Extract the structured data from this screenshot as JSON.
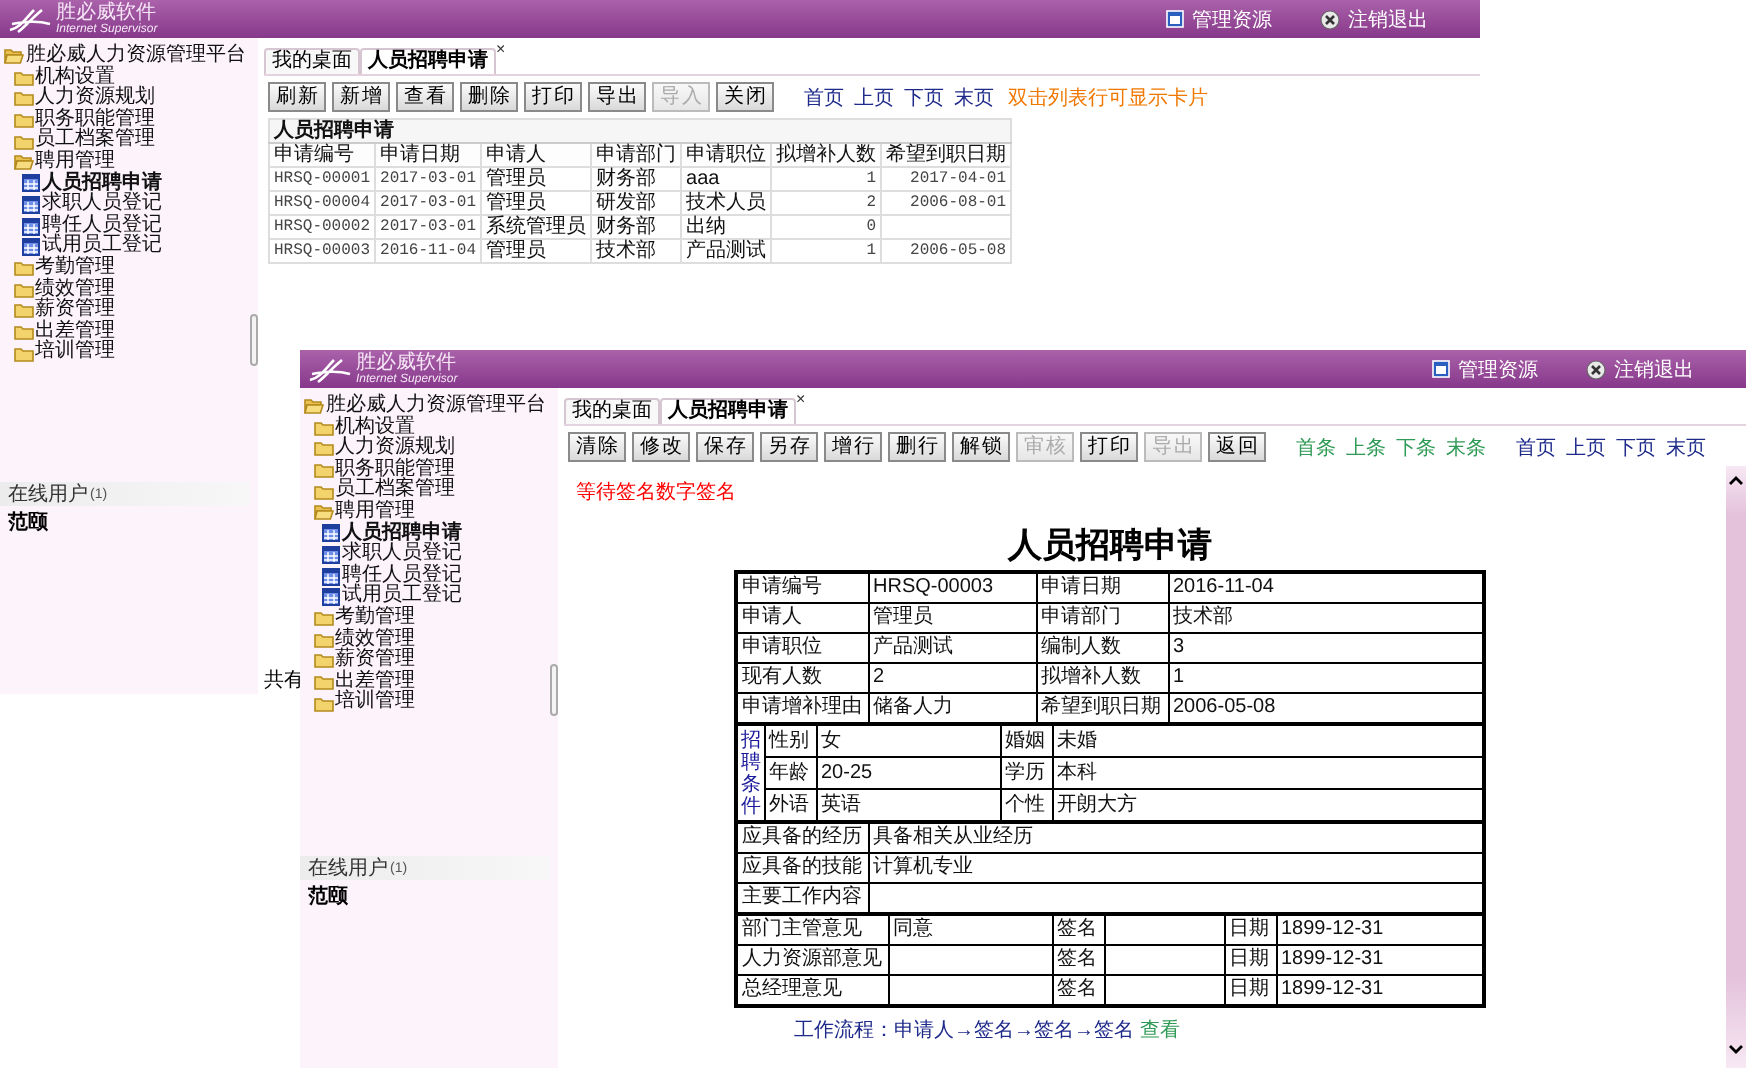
{
  "windows": [
    {
      "kind": "list",
      "header": {
        "logo_title": "胜必威软件",
        "logo_subtitle": "Internet Supervisor",
        "links": [
          {
            "label": "管理资源",
            "kind": "resources"
          },
          {
            "label": "注销退出",
            "kind": "logout"
          }
        ]
      },
      "sidebar": {
        "tree": [
          {
            "label": "胜必威人力资源管理平台",
            "kind": "folder",
            "expanded": true,
            "selected": false,
            "children": [
              {
                "label": "机构设置",
                "kind": "folder",
                "expanded": false,
                "selected": false
              },
              {
                "label": "人力资源规划",
                "kind": "folder",
                "expanded": false,
                "selected": false
              },
              {
                "label": "职务职能管理",
                "kind": "folder",
                "expanded": false,
                "selected": false
              },
              {
                "label": "员工档案管理",
                "kind": "folder",
                "expanded": false,
                "selected": false
              },
              {
                "label": "聘用管理",
                "kind": "folder",
                "expanded": true,
                "selected": false,
                "children": [
                  {
                    "label": "人员招聘申请",
                    "kind": "page",
                    "selected": true
                  },
                  {
                    "label": "求职人员登记",
                    "kind": "page",
                    "selected": false
                  },
                  {
                    "label": "聘任人员登记",
                    "kind": "page",
                    "selected": false
                  },
                  {
                    "label": "试用员工登记",
                    "kind": "page",
                    "selected": false
                  }
                ]
              },
              {
                "label": "考勤管理",
                "kind": "folder",
                "expanded": false,
                "selected": false
              },
              {
                "label": "绩效管理",
                "kind": "folder",
                "expanded": false,
                "selected": false
              },
              {
                "label": "薪资管理",
                "kind": "folder",
                "expanded": false,
                "selected": false
              },
              {
                "label": "出差管理",
                "kind": "folder",
                "expanded": false,
                "selected": false
              },
              {
                "label": "培训管理",
                "kind": "folder",
                "expanded": false,
                "selected": false
              }
            ]
          }
        ],
        "online_users": {
          "label": "在线用户",
          "count": "(1)",
          "users": [
            "范颐"
          ]
        }
      },
      "tabs": [
        {
          "label": "我的桌面",
          "selected": false
        },
        {
          "label": "人员招聘申请",
          "selected": true,
          "close": "×"
        }
      ],
      "toolbar": {
        "buttons": [
          {
            "label": "刷新",
            "disabled": false
          },
          {
            "label": "新增",
            "disabled": false
          },
          {
            "label": "查看",
            "disabled": false
          },
          {
            "label": "删除",
            "disabled": false
          },
          {
            "label": "打印",
            "disabled": false
          },
          {
            "label": "导出",
            "disabled": false
          },
          {
            "label": "导入",
            "disabled": true
          },
          {
            "label": "关闭",
            "disabled": false
          }
        ],
        "links": [
          {
            "label": "首页",
            "kind": "page"
          },
          {
            "label": "上页",
            "kind": "page"
          },
          {
            "label": "下页",
            "kind": "page"
          },
          {
            "label": "末页",
            "kind": "page"
          }
        ],
        "hint": "双击列表行可显示卡片"
      },
      "list": {
        "title": "人员招聘申请",
        "columns": [
          {
            "label": "申请编号",
            "kind": "code"
          },
          {
            "label": "申请日期",
            "kind": "date"
          },
          {
            "label": "申请人",
            "kind": "text"
          },
          {
            "label": "申请部门",
            "kind": "text"
          },
          {
            "label": "申请职位",
            "kind": "text"
          },
          {
            "label": "拟增补人数",
            "kind": "number"
          },
          {
            "label": "希望到职日期",
            "kind": "date"
          }
        ],
        "rows": [
          [
            "HRSQ-00001",
            "2017-03-01",
            "管理员",
            "财务部",
            "aaa",
            "1",
            "2017-04-01"
          ],
          [
            "HRSQ-00004",
            "2017-03-01",
            "管理员",
            "研发部",
            "技术人员",
            "2",
            "2006-08-01"
          ],
          [
            "HRSQ-00002",
            "2017-03-01",
            "系统管理员",
            "财务部",
            "出纳",
            "0",
            null
          ],
          [
            "HRSQ-00003",
            "2016-11-04",
            "管理员",
            "技术部",
            "产品测试",
            "1",
            "2006-05-08"
          ]
        ]
      },
      "footer": "共有"
    },
    {
      "kind": "form",
      "header": {
        "logo_title": "胜必威软件",
        "logo_subtitle": "Internet Supervisor",
        "links": [
          {
            "label": "管理资源",
            "kind": "resources"
          },
          {
            "label": "注销退出",
            "kind": "logout"
          }
        ]
      },
      "sidebar": {
        "tree": [
          {
            "label": "胜必威人力资源管理平台",
            "kind": "folder",
            "expanded": true,
            "selected": false,
            "children": [
              {
                "label": "机构设置",
                "kind": "folder",
                "expanded": false,
                "selected": false
              },
              {
                "label": "人力资源规划",
                "kind": "folder",
                "expanded": false,
                "selected": false
              },
              {
                "label": "职务职能管理",
                "kind": "folder",
                "expanded": false,
                "selected": false
              },
              {
                "label": "员工档案管理",
                "kind": "folder",
                "expanded": false,
                "selected": false
              },
              {
                "label": "聘用管理",
                "kind": "folder",
                "expanded": true,
                "selected": false,
                "children": [
                  {
                    "label": "人员招聘申请",
                    "kind": "page",
                    "selected": true
                  },
                  {
                    "label": "求职人员登记",
                    "kind": "page",
                    "selected": false
                  },
                  {
                    "label": "聘任人员登记",
                    "kind": "page",
                    "selected": false
                  },
                  {
                    "label": "试用员工登记",
                    "kind": "page",
                    "selected": false
                  }
                ]
              },
              {
                "label": "考勤管理",
                "kind": "folder",
                "expanded": false,
                "selected": false
              },
              {
                "label": "绩效管理",
                "kind": "folder",
                "expanded": false,
                "selected": false
              },
              {
                "label": "薪资管理",
                "kind": "folder",
                "expanded": false,
                "selected": false
              },
              {
                "label": "出差管理",
                "kind": "folder",
                "expanded": false,
                "selected": false
              },
              {
                "label": "培训管理",
                "kind": "folder",
                "expanded": false,
                "selected": false
              }
            ]
          }
        ],
        "online_users": {
          "label": "在线用户",
          "count": "(1)",
          "users": [
            "范颐"
          ]
        }
      },
      "tabs": [
        {
          "label": "我的桌面",
          "selected": false
        },
        {
          "label": "人员招聘申请",
          "selected": true,
          "close": "×"
        }
      ],
      "toolbar": {
        "buttons": [
          {
            "label": "清除",
            "disabled": false
          },
          {
            "label": "修改",
            "disabled": false
          },
          {
            "label": "保存",
            "disabled": false
          },
          {
            "label": "另存",
            "disabled": false
          },
          {
            "label": "增行",
            "disabled": false
          },
          {
            "label": "删行",
            "disabled": false
          },
          {
            "label": "解锁",
            "disabled": false
          },
          {
            "label": "审核",
            "disabled": true
          },
          {
            "label": "打印",
            "disabled": false
          },
          {
            "label": "导出",
            "disabled": true
          },
          {
            "label": "返回",
            "disabled": false
          }
        ],
        "links": [
          {
            "label": "首条",
            "kind": "record"
          },
          {
            "label": "上条",
            "kind": "record"
          },
          {
            "label": "下条",
            "kind": "record"
          },
          {
            "label": "末条",
            "kind": "record"
          },
          {
            "label": "首页",
            "kind": "page"
          },
          {
            "label": "上页",
            "kind": "page"
          },
          {
            "label": "下页",
            "kind": "page"
          },
          {
            "label": "末页",
            "kind": "page"
          }
        ]
      },
      "notice": "等待签名数字签名",
      "form": {
        "title": "人员招聘申请",
        "basic": [
          [
            {
              "label": "申请编号",
              "value": "HRSQ-00003"
            },
            {
              "label": "申请日期",
              "value": "2016-11-04"
            }
          ],
          [
            {
              "label": "申请人",
              "value": "管理员"
            },
            {
              "label": "申请部门",
              "value": "技术部"
            }
          ],
          [
            {
              "label": "申请职位",
              "value": "产品测试"
            },
            {
              "label": "编制人数",
              "value": "3"
            }
          ],
          [
            {
              "label": "现有人数",
              "value": "2"
            },
            {
              "label": "拟增补人数",
              "value": "1"
            }
          ],
          [
            {
              "label": "申请增补理由",
              "value": "储备人力"
            },
            {
              "label": "希望到职日期",
              "value": "2006-05-08"
            }
          ]
        ],
        "conditions": {
          "heading": "招聘条件",
          "rows": [
            [
              {
                "label": "性别",
                "value": "女"
              },
              {
                "label": "婚姻",
                "value": "未婚"
              }
            ],
            [
              {
                "label": "年龄",
                "value": "20-25"
              },
              {
                "label": "学历",
                "value": "本科"
              }
            ],
            [
              {
                "label": "外语",
                "value": "英语"
              },
              {
                "label": "个性",
                "value": "开朗大方"
              }
            ]
          ]
        },
        "requirements": [
          {
            "label": "应具备的经历",
            "value": "具备相关从业经历"
          },
          {
            "label": "应具备的技能",
            "value": "计算机专业"
          },
          {
            "label": "主要工作内容"
          }
        ],
        "approvals": [
          {
            "label": "部门主管意见",
            "opinion": "同意",
            "sign_label": "签名",
            "date_label": "日期",
            "date": "1899-12-31"
          },
          {
            "label": "人力资源部意见",
            "sign_label": "签名",
            "date_label": "日期",
            "date": "1899-12-31"
          },
          {
            "label": "总经理意见",
            "sign_label": "签名",
            "date_label": "日期",
            "date": "1899-12-31"
          }
        ]
      },
      "workflow": {
        "label": "工作流程：申请人→签名→签名→签名",
        "link": "查看"
      }
    }
  ]
}
